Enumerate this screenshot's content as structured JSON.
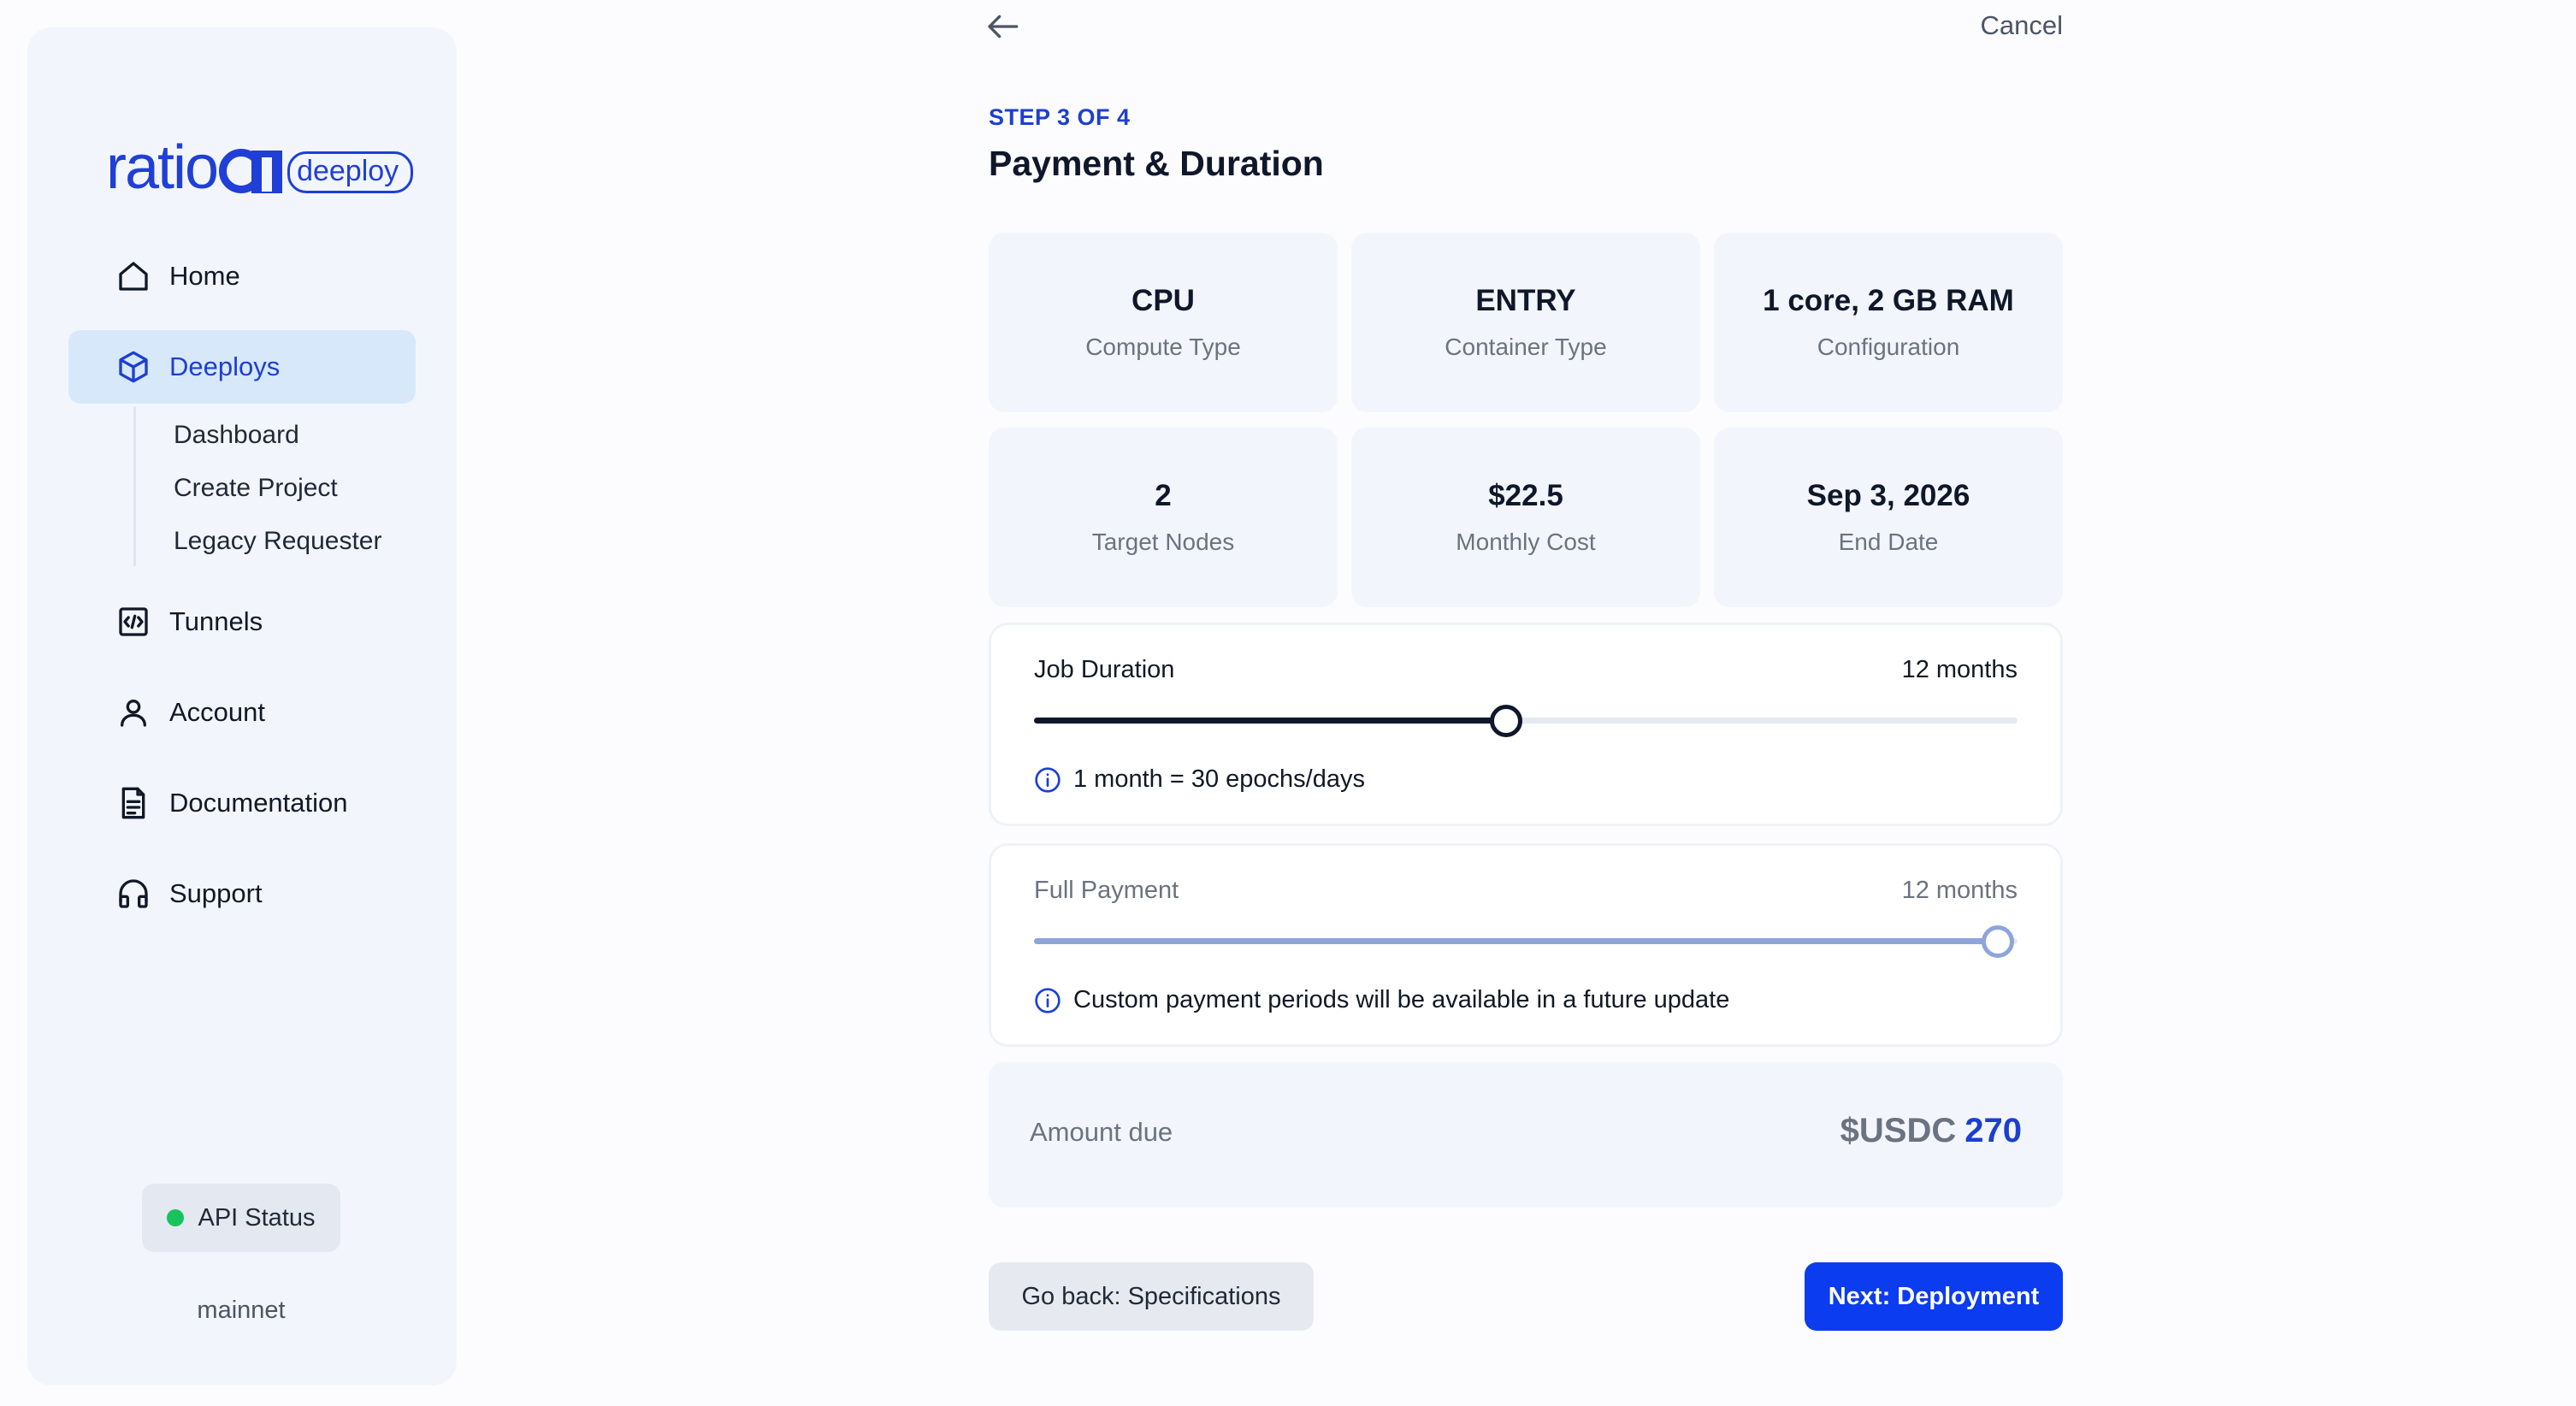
{
  "brand": {
    "logo_text": "ratio",
    "logo_badge": "deeploy"
  },
  "sidebar": {
    "nav": [
      {
        "label": "Home",
        "icon": "home-icon"
      },
      {
        "label": "Deeploys",
        "icon": "cube-icon"
      },
      {
        "label": "Tunnels",
        "icon": "code-window-icon"
      },
      {
        "label": "Account",
        "icon": "user-icon"
      },
      {
        "label": "Documentation",
        "icon": "document-icon"
      },
      {
        "label": "Support",
        "icon": "headphones-icon"
      }
    ],
    "sub_nav": [
      "Dashboard",
      "Create Project",
      "Legacy Requester"
    ],
    "api_status": {
      "label": "API Status",
      "network": "mainnet",
      "status_color": "#16c45b"
    }
  },
  "header": {
    "cancel_label": "Cancel",
    "step": "STEP 3 OF 4",
    "title": "Payment & Duration"
  },
  "summary": [
    {
      "value": "CPU",
      "label": "Compute Type"
    },
    {
      "value": "ENTRY",
      "label": "Container Type"
    },
    {
      "value": "1 core, 2 GB RAM",
      "label": "Configuration"
    },
    {
      "value": "2",
      "label": "Target Nodes"
    },
    {
      "value": "$22.5",
      "label": "Monthly Cost"
    },
    {
      "value": "Sep 3, 2026",
      "label": "End Date"
    }
  ],
  "job_duration": {
    "title": "Job Duration",
    "value_label": "12 months",
    "slider_fraction": 0.48,
    "note": "1 month = 30 epochs/days"
  },
  "full_payment": {
    "title": "Full Payment",
    "value_label": "12 months",
    "slider_fraction": 0.98,
    "note": "Custom payment periods will be available in a future update"
  },
  "amount": {
    "label": "Amount due",
    "currency": "$USDC",
    "value": "270"
  },
  "actions": {
    "back_label": "Go back: Specifications",
    "next_label": "Next: Deployment"
  },
  "colors": {
    "accent": "#1d3fd0",
    "primary_button": "#0b3cf0",
    "slider_dark": "#0f172a",
    "slider_muted": "#8ea4dc"
  }
}
